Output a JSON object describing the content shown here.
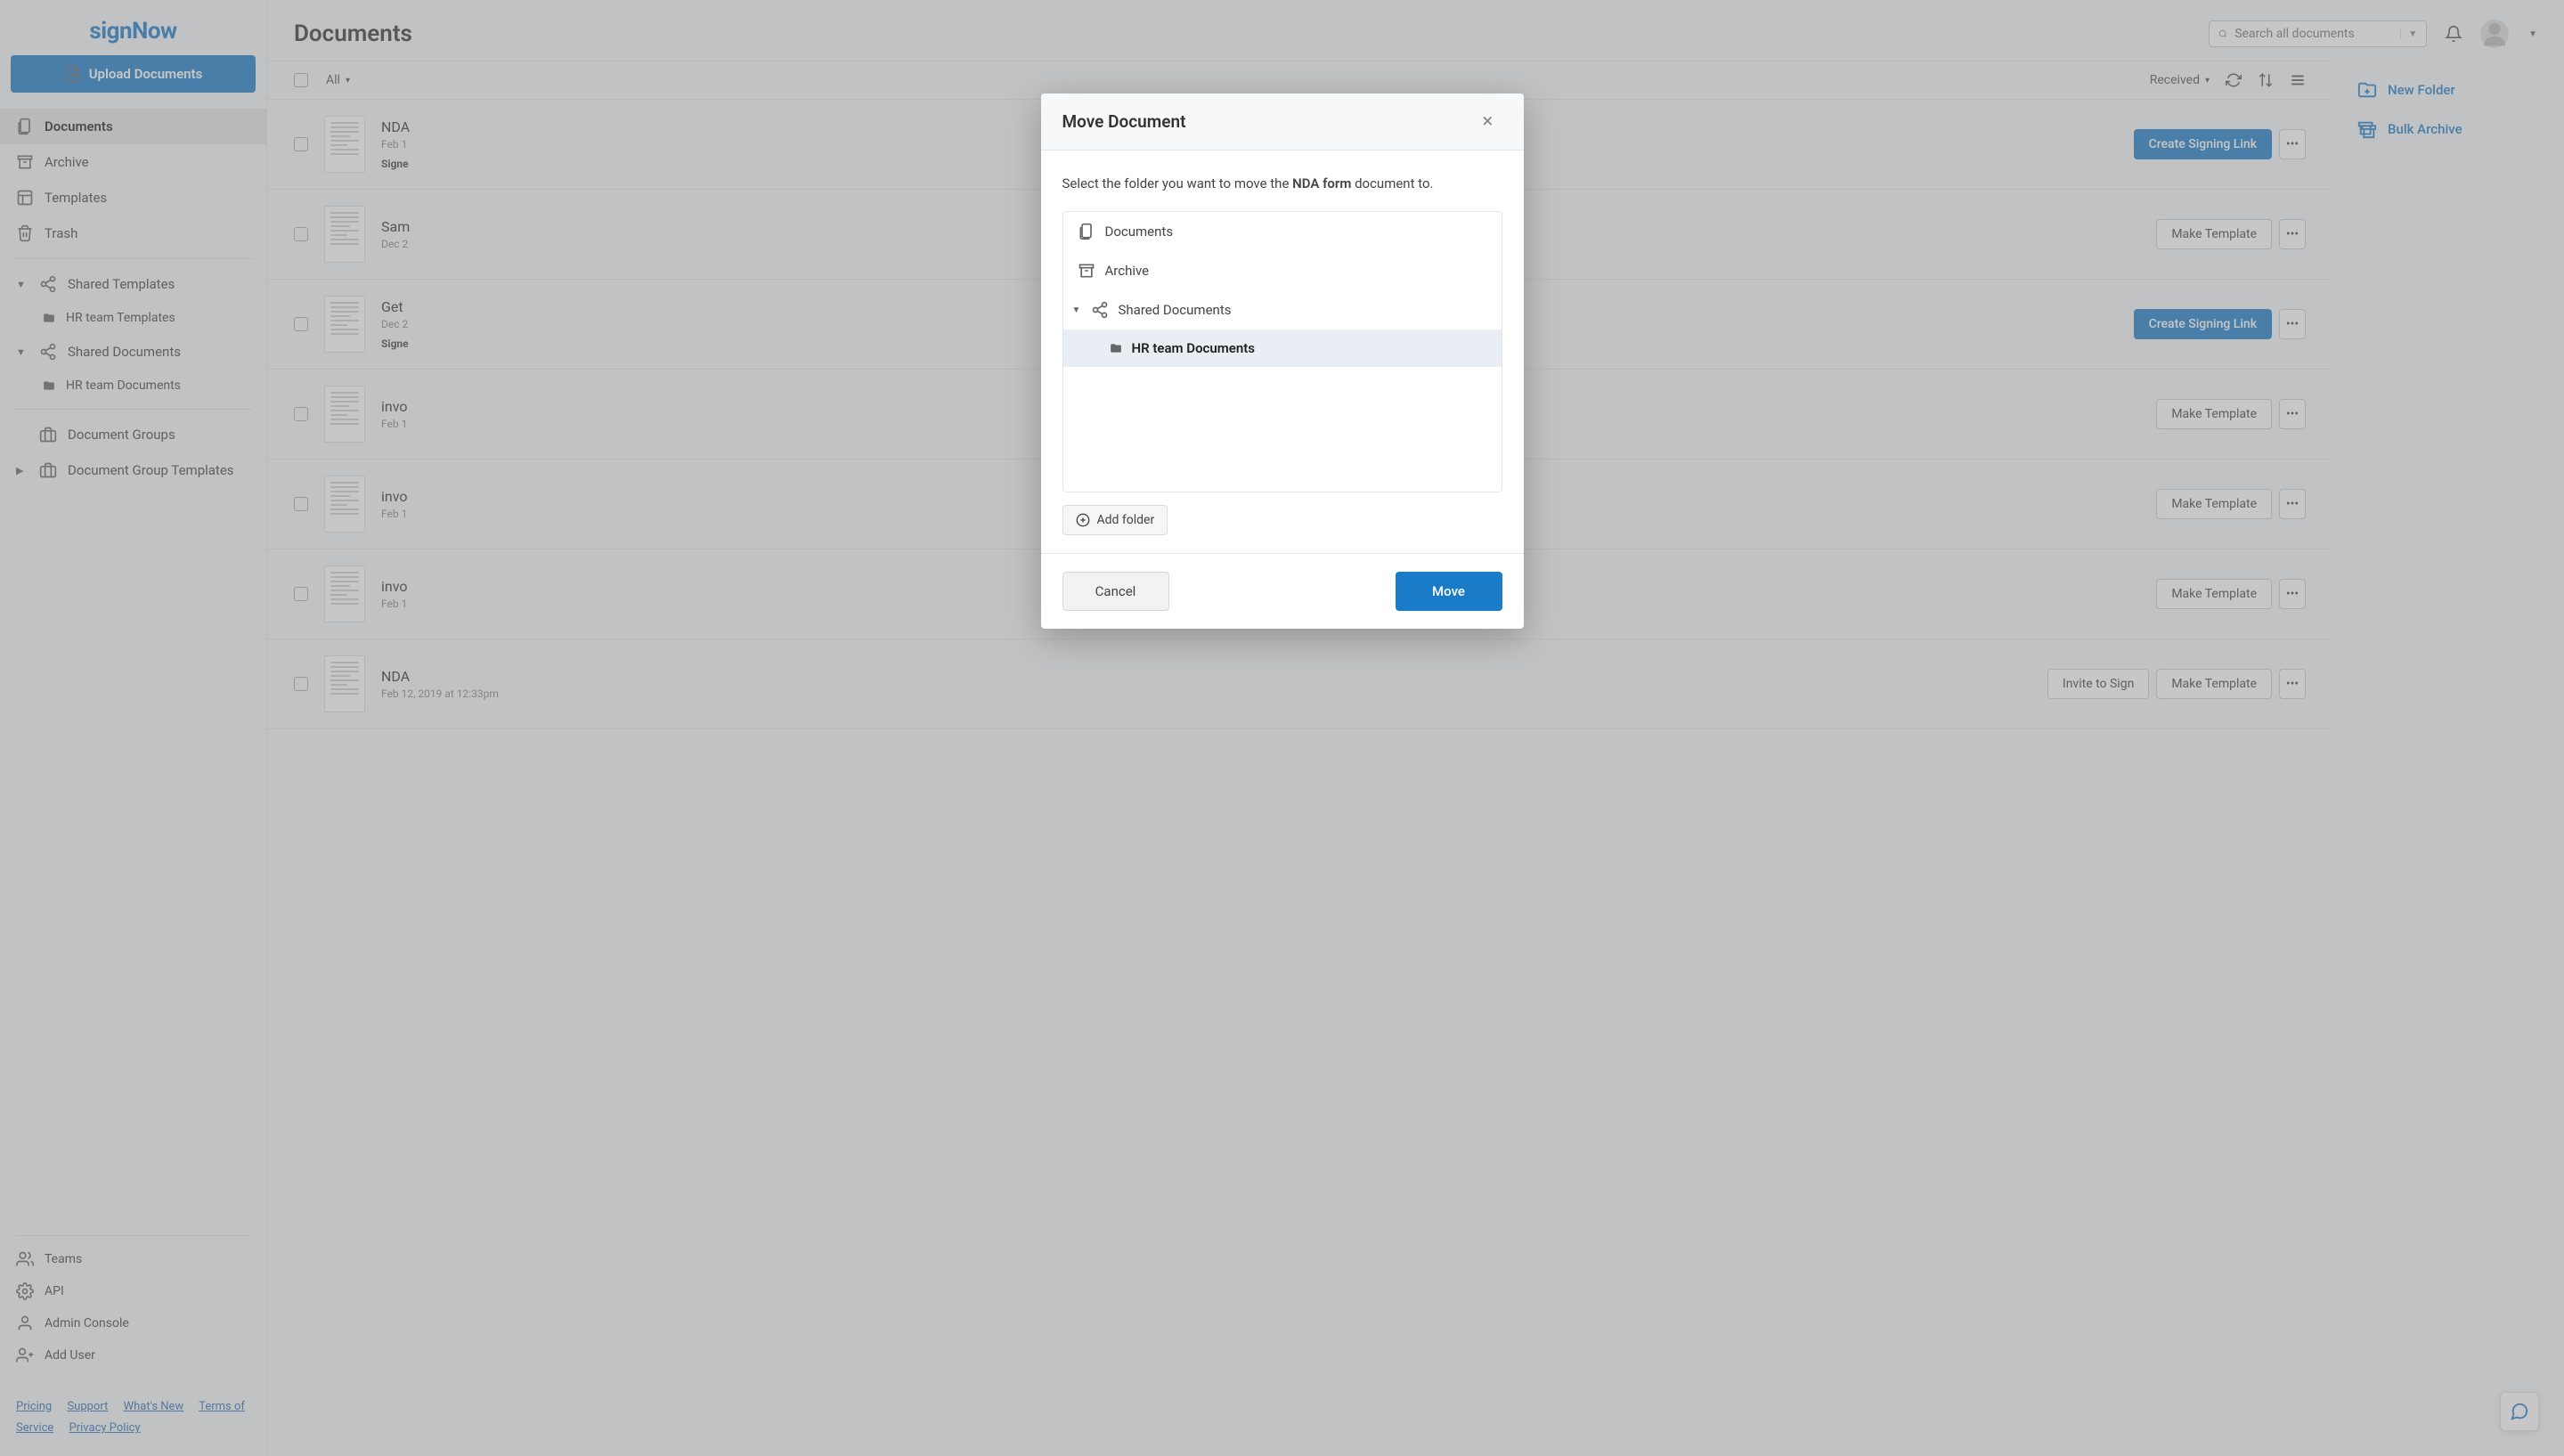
{
  "brand": "signNow",
  "upload_label": "Upload Documents",
  "sidebar": {
    "main": [
      {
        "label": "Documents",
        "icon": "documents-icon",
        "active": true
      },
      {
        "label": "Archive",
        "icon": "archive-icon"
      },
      {
        "label": "Templates",
        "icon": "templates-icon"
      },
      {
        "label": "Trash",
        "icon": "trash-icon"
      }
    ],
    "shared": [
      {
        "label": "Shared Templates",
        "children": [
          {
            "label": "HR team Templates"
          }
        ]
      },
      {
        "label": "Shared Documents",
        "children": [
          {
            "label": "HR team Documents"
          }
        ]
      }
    ],
    "groups": [
      {
        "label": "Document Groups"
      },
      {
        "label": "Document Group Templates",
        "expandable": true
      }
    ],
    "bottom": [
      {
        "label": "Teams",
        "icon": "teams-icon"
      },
      {
        "label": "API",
        "icon": "gear-icon"
      },
      {
        "label": "Admin Console",
        "icon": "user-icon"
      },
      {
        "label": "Add User",
        "icon": "add-user-icon"
      }
    ],
    "footer": [
      "Pricing",
      "Support",
      "What's New",
      "Terms of Service",
      "Privacy Policy"
    ]
  },
  "header": {
    "title": "Documents",
    "search_placeholder": "Search all documents"
  },
  "right_rail": [
    {
      "label": "New Folder",
      "icon": "new-folder-icon"
    },
    {
      "label": "Bulk Archive",
      "icon": "bulk-archive-icon"
    }
  ],
  "toolbar": {
    "filter": "All",
    "sort_received": "Received"
  },
  "documents": [
    {
      "title": "NDA",
      "date": "Feb 1",
      "status": "Signe",
      "primary_action": "Create Signing Link",
      "secondary_action": ""
    },
    {
      "title": "Sam",
      "date": "Dec 2",
      "status": "",
      "primary_action": "",
      "secondary_action": "Make Template"
    },
    {
      "title": "Get ",
      "date": "Dec 2",
      "status": "Signe",
      "primary_action": "Create Signing Link",
      "secondary_action": ""
    },
    {
      "title": "invo",
      "date": "Feb 1",
      "status": "",
      "primary_action": "",
      "secondary_action": "Make Template"
    },
    {
      "title": "invo",
      "date": "Feb 1",
      "status": "",
      "primary_action": "",
      "secondary_action": "Make Template"
    },
    {
      "title": "invo",
      "date": "Feb 1",
      "status": "",
      "primary_action": "",
      "secondary_action": "Make Template"
    },
    {
      "title": "NDA",
      "date": "Feb 12, 2019 at 12:33pm",
      "status": "",
      "primary_action": "",
      "secondary_action": "Make Template",
      "invite": "Invite to Sign"
    }
  ],
  "modal": {
    "title": "Move Document",
    "desc_pre": "Select the folder you want to move the ",
    "doc_name": "NDA form",
    "desc_post": " document to.",
    "tree": [
      {
        "label": "Documents",
        "icon": "documents-icon"
      },
      {
        "label": "Archive",
        "icon": "archive-icon"
      },
      {
        "label": "Shared Documents",
        "icon": "share-icon",
        "expanded": true,
        "children": [
          {
            "label": "HR team Documents",
            "selected": true
          }
        ]
      }
    ],
    "add_folder": "Add folder",
    "cancel": "Cancel",
    "move": "Move"
  }
}
